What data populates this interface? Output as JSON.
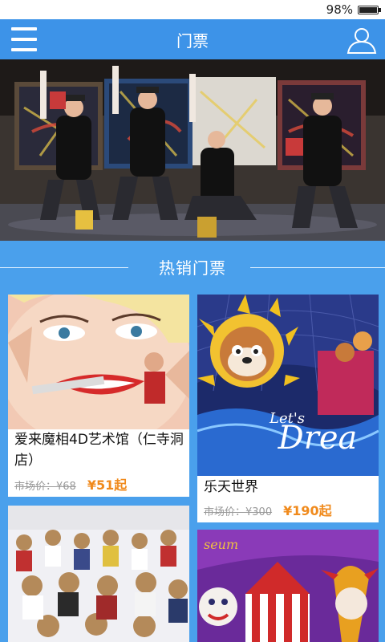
{
  "status_bar": {
    "battery_text": "98%",
    "battery_level": 0.98
  },
  "header": {
    "title": "门票",
    "menu_icon": "menu-icon",
    "user_icon": "user-icon"
  },
  "hero": {
    "image_icon": "painting-performers-photo"
  },
  "section": {
    "title": "热销门票"
  },
  "cards": [
    {
      "name": "爱来魔相4D艺术馆（仁寺洞店）",
      "market_label": "市场价：¥68",
      "price": "¥51起",
      "image": "3d-art-museum-photo"
    },
    {
      "name": "乐天世界",
      "market_label": "市场价：¥300",
      "price": "¥190起",
      "image": "lotte-world-photo"
    },
    {
      "name": "",
      "market_label": "",
      "price": "",
      "image": "teddy-bear-museum-photo"
    },
    {
      "name": "",
      "market_label": "",
      "price": "",
      "image": "circus-museum-photo"
    }
  ],
  "colors": {
    "bar": "#3d93e8",
    "background": "#4aa0ec",
    "price": "#f08a1c"
  }
}
